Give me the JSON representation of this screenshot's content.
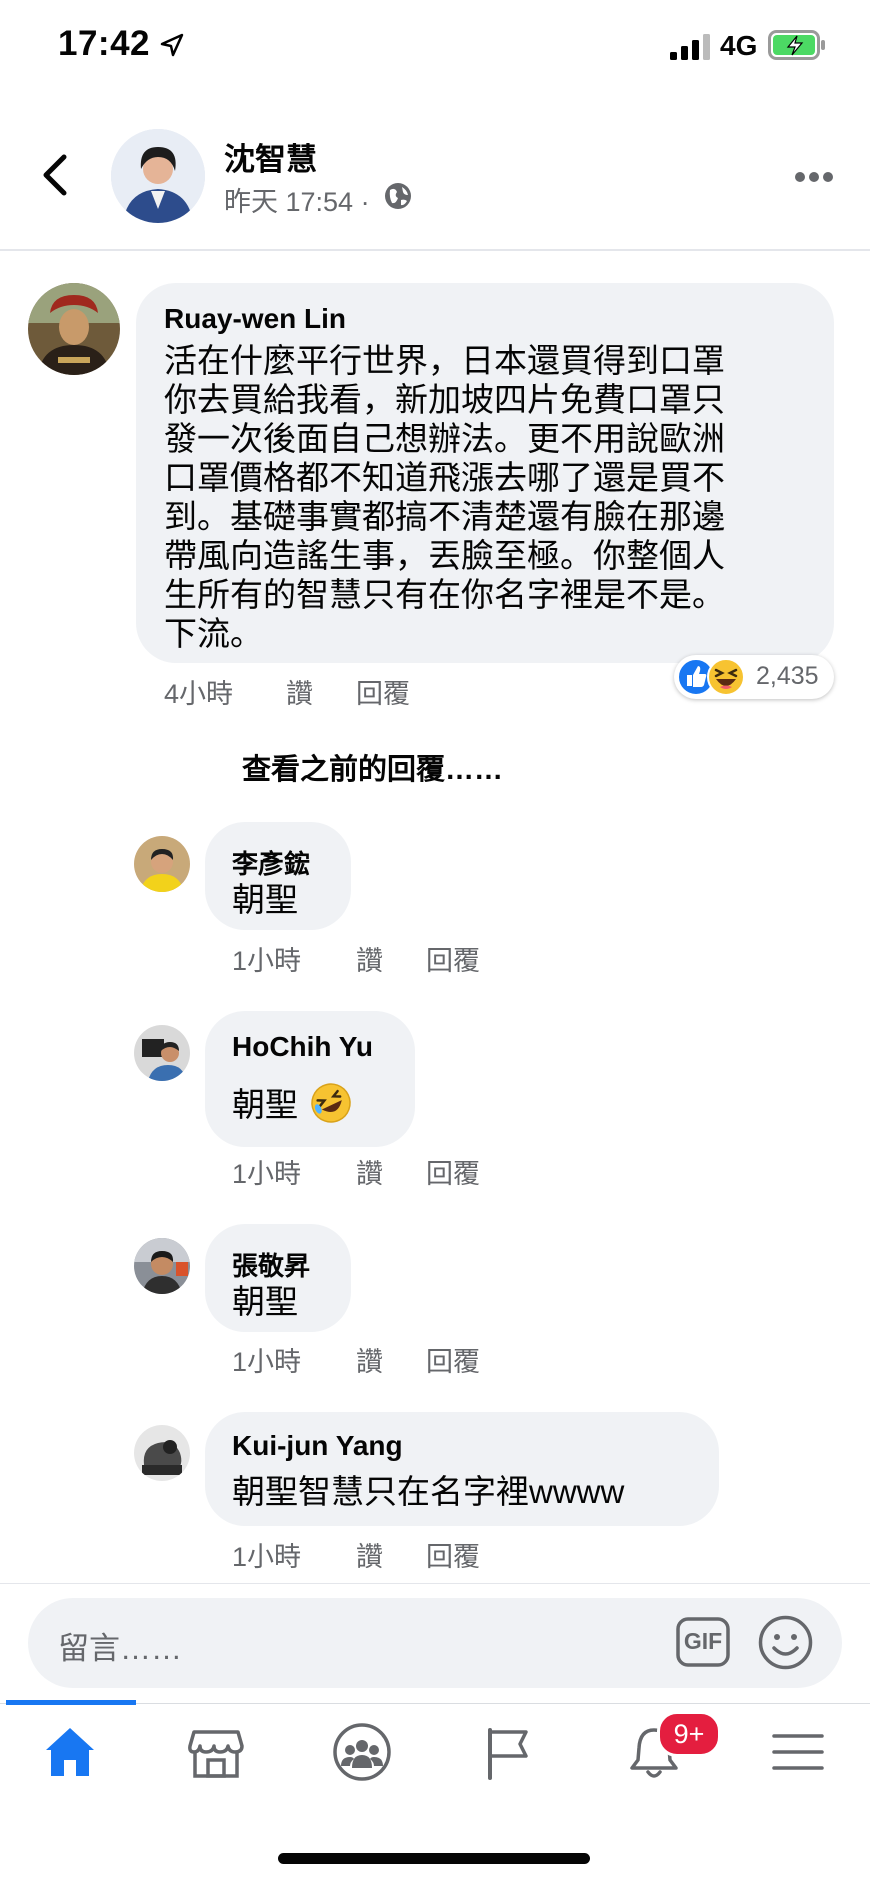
{
  "status_bar": {
    "time": "17:42",
    "network": "4G"
  },
  "header": {
    "page_name": "沈智慧",
    "post_time": "昨天 17:54 ·"
  },
  "top_comment": {
    "author": "Ruay-wen Lin",
    "lines": [
      "活在什麼平行世界，日本還買得到口罩",
      "你去買給我看，新加坡四片免費口罩只",
      "發一次後面自己想辦法。更不用說歐洲",
      "口罩價格都不知道飛漲去哪了還是買不",
      "到。基礎事實都搞不清楚還有臉在那邊",
      "帶風向造謠生事，丟臉至極。你整個人",
      "生所有的智慧只有在你名字裡是不是。",
      "下流。"
    ],
    "time": "4小時",
    "like": "讚",
    "reply": "回覆",
    "reaction_count": "2,435"
  },
  "view_previous": "查看之前的回覆……",
  "replies": [
    {
      "author": "李彥鋐",
      "text": "朝聖",
      "time": "1小時",
      "like": "讚",
      "reply": "回覆"
    },
    {
      "author": "HoChih Yu",
      "text": "朝聖",
      "time": "1小時",
      "like": "讚",
      "reply": "回覆"
    },
    {
      "author": "張敬昇",
      "text": "朝聖",
      "time": "1小時",
      "like": "讚",
      "reply": "回覆"
    },
    {
      "author": "Kui-jun Yang",
      "text": "朝聖智慧只在名字裡wwww",
      "time": "1小時",
      "like": "讚",
      "reply": "回覆"
    }
  ],
  "composer": {
    "placeholder": "留言……",
    "gif_label": "GIF"
  },
  "tabs": {
    "items": [
      "home-icon",
      "marketplace-icon",
      "groups-icon",
      "pages-flag-icon",
      "notifications-bell-icon",
      "menu-icon"
    ],
    "notification_badge": "9+"
  },
  "colors": {
    "accent": "#1877f2",
    "badge": "#e41e3f",
    "bubble": "#f0f2f5",
    "secondary_text": "#65676b"
  }
}
